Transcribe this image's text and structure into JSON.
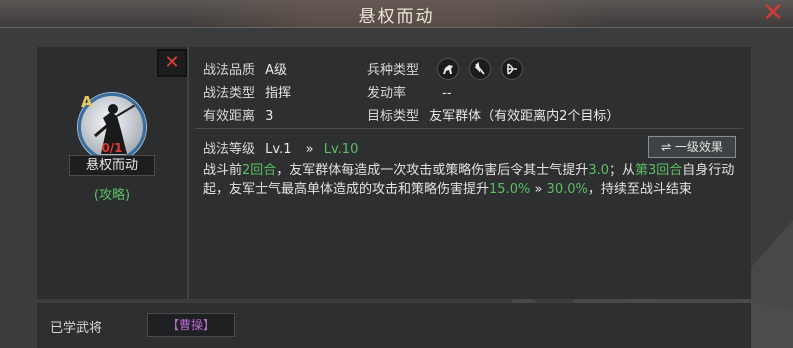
{
  "window": {
    "title": "悬权而动",
    "close_glyph": "✕"
  },
  "skill_card": {
    "close_glyph": "✕",
    "grade_letter": "A",
    "level": "0/1",
    "name": "悬权而动",
    "strategy_link": "(攻略)"
  },
  "info": {
    "quality_label": "战法品质",
    "quality_value": "A级",
    "unit_type_label": "兵种类型",
    "unit_icons": [
      "cavalry-icon",
      "shield-icon",
      "bow-icon"
    ],
    "type_label": "战法类型",
    "type_value": "指挥",
    "trigger_label": "发动率",
    "trigger_value": "--",
    "range_label": "有效距离",
    "range_value": "3",
    "target_label": "目标类型",
    "target_value": "友军群体（有效距离内2个目标）"
  },
  "level_row": {
    "label": "战法等级",
    "from": "Lv.1",
    "arrow": "»",
    "to": "Lv.10",
    "effect_button": "⇌ 一级效果"
  },
  "description": {
    "p1": "战斗前",
    "h1": "2回合",
    "p2": "，友军群体每造成一次攻击或策略伤害后令其士气提升",
    "h2": "3.0",
    "p3": "；从",
    "h3": "第3回合",
    "p4": "自身行动起，友军士气最高单体造成的攻击和策略伤害提升",
    "h4": "15.0%",
    "p5": " » ",
    "h5": "30.0%",
    "p6": "，持续至战斗结束"
  },
  "learned": {
    "label": "已学武将",
    "general": "【曹操】"
  },
  "colors": {
    "accent_green": "#5cbf62",
    "close_red": "#d23a34",
    "general_purple": "#b56ad0",
    "grade_gold": "#e6c65a"
  }
}
